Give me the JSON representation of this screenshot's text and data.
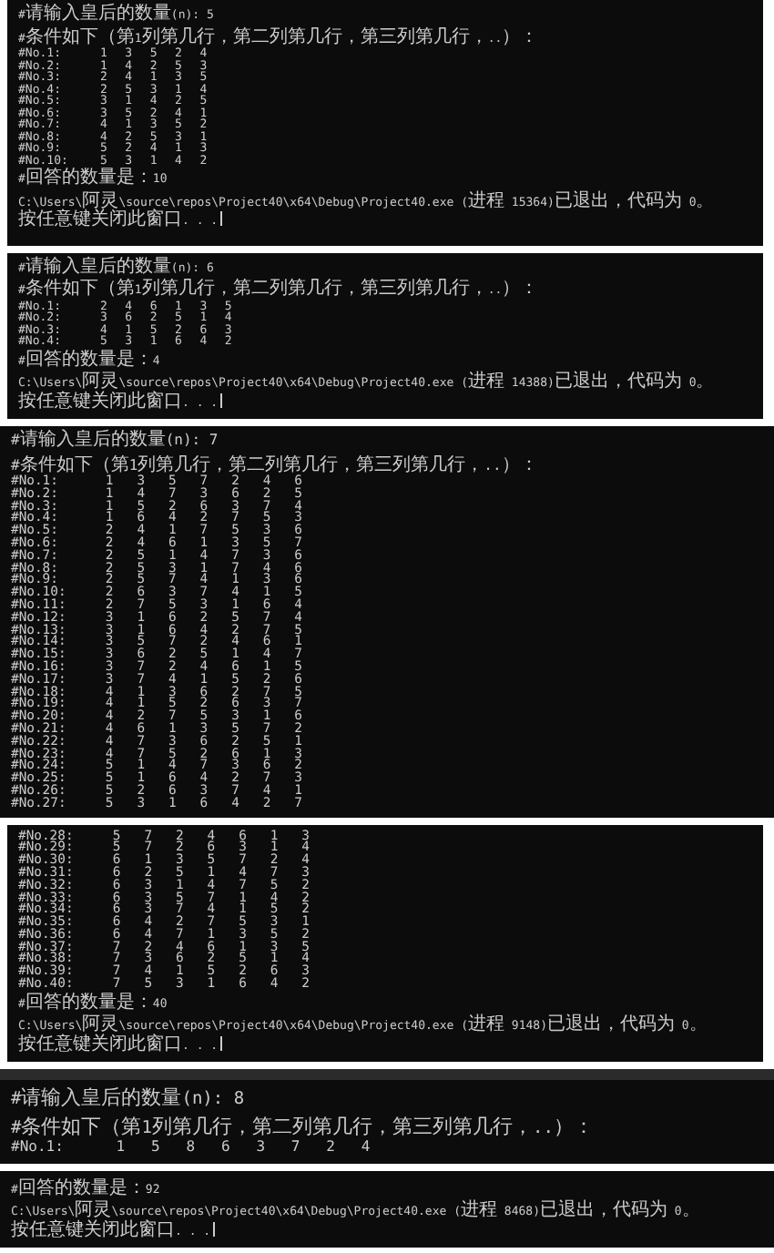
{
  "consoles": [
    {
      "kind": "plain",
      "lines": [
        {
          "kind": "prompt",
          "text": "#请输入皇后的数量(n): 5"
        },
        {
          "kind": "heading",
          "text": "#条件如下（第1列第几行，第二列第几行，第三列第几行，..）："
        },
        {
          "kind": "row",
          "text": "#No.1: 1 3 5 2 4"
        },
        {
          "kind": "row",
          "text": "#No.2: 1 4 2 5 3"
        },
        {
          "kind": "row",
          "text": "#No.3: 2 4 1 3 5"
        },
        {
          "kind": "row",
          "text": "#No.4: 2 5 3 1 4"
        },
        {
          "kind": "row",
          "text": "#No.5: 3 1 4 2 5"
        },
        {
          "kind": "row",
          "text": "#No.6: 3 5 2 4 1"
        },
        {
          "kind": "row",
          "text": "#No.7: 4 1 3 5 2"
        },
        {
          "kind": "row",
          "text": "#No.8: 4 2 5 3 1"
        },
        {
          "kind": "row",
          "text": "#No.9: 5 2 4 1 3"
        },
        {
          "kind": "row",
          "text": "#No.10: 5 3 1 4 2"
        },
        {
          "kind": "result",
          "text": "#回答的数量是：10"
        },
        {
          "kind": "exit",
          "text": "C:\\Users\\阿灵\\source\\repos\\Project40\\x64\\Debug\\Project40.exe (进程 15364)已退出，代码为 0。"
        },
        {
          "kind": "hint",
          "text": "按任意键关闭此窗口. . ."
        }
      ]
    },
    {
      "kind": "plain",
      "lines": [
        {
          "kind": "prompt",
          "text": "#请输入皇后的数量(n): 6"
        },
        {
          "kind": "heading",
          "text": "#条件如下（第1列第几行，第二列第几行，第三列第几行，..）："
        },
        {
          "kind": "row",
          "text": "#No.1: 2 4 6 1 3 5"
        },
        {
          "kind": "row",
          "text": "#No.2: 3 6 2 5 1 4"
        },
        {
          "kind": "row",
          "text": "#No.3: 4 1 5 2 6 3"
        },
        {
          "kind": "row",
          "text": "#No.4: 5 3 1 6 4 2"
        },
        {
          "kind": "result",
          "text": "#回答的数量是：4"
        },
        {
          "kind": "exit",
          "text": "C:\\Users\\阿灵\\source\\repos\\Project40\\x64\\Debug\\Project40.exe (进程 14388)已退出，代码为 0。"
        },
        {
          "kind": "hint",
          "text": "按任意键关闭此窗口. . ."
        }
      ]
    },
    {
      "kind": "plain",
      "lines": [
        {
          "kind": "prompt",
          "text": "#请输入皇后的数量(n): 7"
        },
        {
          "kind": "heading",
          "text": "#条件如下（第1列第几行，第二列第几行，第三列第几行，..）："
        },
        {
          "kind": "row",
          "text": "#No.1: 1 3 5 7 2 4 6"
        },
        {
          "kind": "row",
          "text": "#No.2: 1 4 7 3 6 2 5"
        },
        {
          "kind": "row",
          "text": "#No.3: 1 5 2 6 3 7 4"
        },
        {
          "kind": "row",
          "text": "#No.4: 1 6 4 2 7 5 3"
        },
        {
          "kind": "row",
          "text": "#No.5: 2 4 1 7 5 3 6"
        },
        {
          "kind": "row",
          "text": "#No.6: 2 4 6 1 3 5 7"
        },
        {
          "kind": "row",
          "text": "#No.7: 2 5 1 4 7 3 6"
        },
        {
          "kind": "row",
          "text": "#No.8: 2 5 3 1 7 4 6"
        },
        {
          "kind": "row",
          "text": "#No.9: 2 5 7 4 1 3 6"
        },
        {
          "kind": "row",
          "text": "#No.10: 2 6 3 7 4 1 5"
        },
        {
          "kind": "row",
          "text": "#No.11: 2 7 5 3 1 6 4"
        },
        {
          "kind": "row",
          "text": "#No.12: 3 1 6 2 5 7 4"
        },
        {
          "kind": "row",
          "text": "#No.13: 3 1 6 4 2 7 5"
        },
        {
          "kind": "row",
          "text": "#No.14: 3 5 7 2 4 6 1"
        },
        {
          "kind": "row",
          "text": "#No.15: 3 6 2 5 1 4 7"
        },
        {
          "kind": "row",
          "text": "#No.16: 3 7 2 4 6 1 5"
        },
        {
          "kind": "row",
          "text": "#No.17: 3 7 4 1 5 2 6"
        },
        {
          "kind": "row",
          "text": "#No.18: 4 1 3 6 2 7 5"
        },
        {
          "kind": "row",
          "text": "#No.19: 4 1 5 2 6 3 7"
        },
        {
          "kind": "row",
          "text": "#No.20: 4 2 7 5 3 1 6"
        },
        {
          "kind": "row",
          "text": "#No.21: 4 6 1 3 5 7 2"
        },
        {
          "kind": "row",
          "text": "#No.22: 4 7 3 6 2 5 1"
        },
        {
          "kind": "row",
          "text": "#No.23: 4 7 5 2 6 1 3"
        },
        {
          "kind": "row",
          "text": "#No.24: 5 1 4 7 3 6 2"
        },
        {
          "kind": "row",
          "text": "#No.25: 5 1 6 4 2 7 3"
        },
        {
          "kind": "row",
          "text": "#No.26: 5 2 6 3 7 4 1"
        },
        {
          "kind": "row",
          "text": "#No.27: 5 3 1 6 4 2 7"
        }
      ]
    },
    {
      "kind": "plain",
      "lines": [
        {
          "kind": "row",
          "text": "#No.28: 5 7 2 4 6 1 3"
        },
        {
          "kind": "row",
          "text": "#No.29: 5 7 2 6 3 1 4"
        },
        {
          "kind": "row",
          "text": "#No.30: 6 1 3 5 7 2 4"
        },
        {
          "kind": "row",
          "text": "#No.31: 6 2 5 1 4 7 3"
        },
        {
          "kind": "row",
          "text": "#No.32: 6 3 1 4 7 5 2"
        },
        {
          "kind": "row",
          "text": "#No.33: 6 3 5 7 1 4 2"
        },
        {
          "kind": "row",
          "text": "#No.34: 6 3 7 4 1 5 2"
        },
        {
          "kind": "row",
          "text": "#No.35: 6 4 2 7 5 3 1"
        },
        {
          "kind": "row",
          "text": "#No.36: 6 4 7 1 3 5 2"
        },
        {
          "kind": "row",
          "text": "#No.37: 7 2 4 6 1 3 5"
        },
        {
          "kind": "row",
          "text": "#No.38: 7 3 6 2 5 1 4"
        },
        {
          "kind": "row",
          "text": "#No.39: 7 4 1 5 2 6 3"
        },
        {
          "kind": "row",
          "text": "#No.40: 7 5 3 1 6 4 2"
        },
        {
          "kind": "result",
          "text": "#回答的数量是：40"
        },
        {
          "kind": "exit",
          "text": "C:\\Users\\阿灵\\source\\repos\\Project40\\x64\\Debug\\Project40.exe (进程 9148)已退出，代码为 0。"
        },
        {
          "kind": "hint",
          "text": "按任意键关闭此窗口. . ."
        }
      ]
    },
    {
      "kind": "tabbed",
      "lines": [
        {
          "kind": "prompt",
          "text": "#请输入皇后的数量(n): 8"
        },
        {
          "kind": "heading",
          "text": "#条件如下（第1列第几行，第二列第几行，第三列第几行，..）："
        },
        {
          "kind": "row",
          "text": "#No.1: 1 5 8 6 3 7 2 4"
        }
      ]
    },
    {
      "kind": "plain",
      "lines": [
        {
          "kind": "result",
          "text": "#回答的数量是：92"
        },
        {
          "kind": "exit",
          "text": "C:\\Users\\阿灵\\source\\repos\\Project40\\x64\\Debug\\Project40.exe (进程 8468)已退出，代码为 0。"
        },
        {
          "kind": "hint",
          "text": "按任意键关闭此窗口. . ."
        }
      ]
    }
  ]
}
